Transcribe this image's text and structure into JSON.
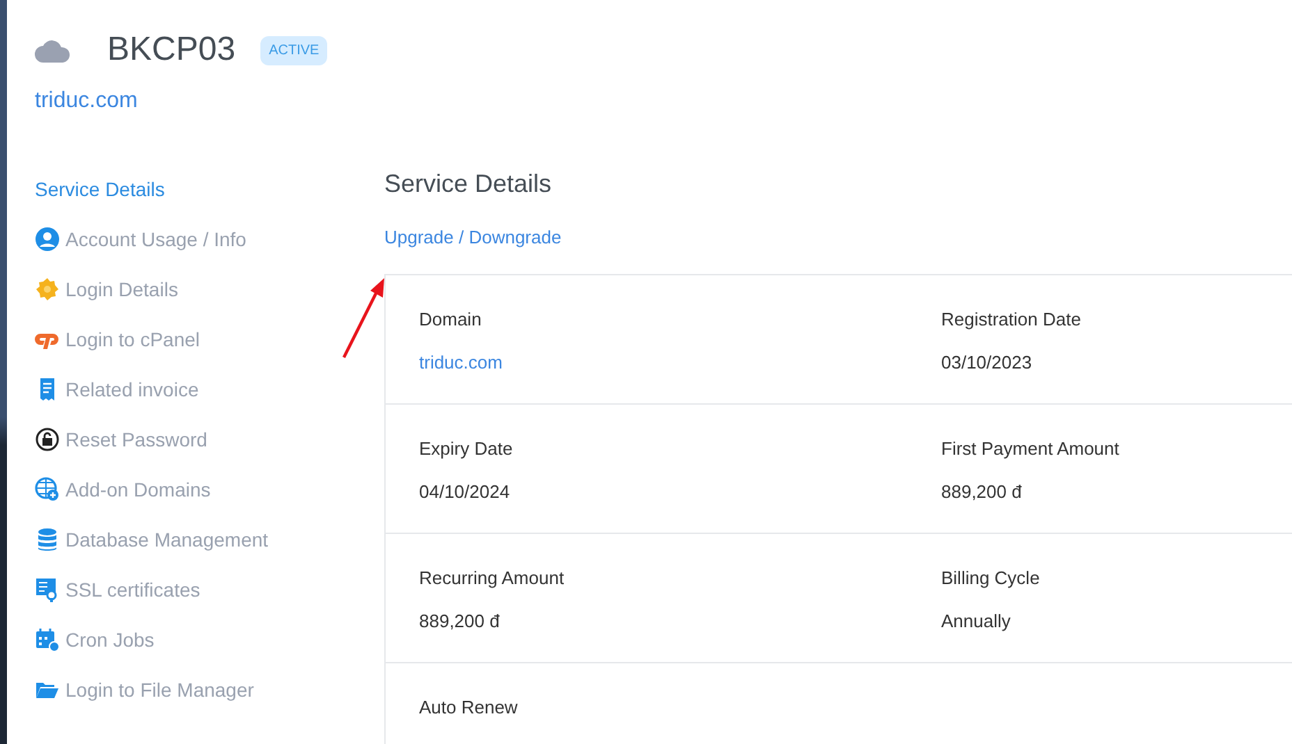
{
  "header": {
    "title": "BKCP03",
    "status": "ACTIVE",
    "domain": "triduc.com"
  },
  "sidebar": {
    "items": [
      {
        "label": "Service Details",
        "selected": true
      },
      {
        "label": "Account Usage / Info",
        "selected": false
      },
      {
        "label": "Login Details",
        "selected": false
      },
      {
        "label": "Login to cPanel",
        "selected": false
      },
      {
        "label": "Related invoice",
        "selected": false
      },
      {
        "label": "Reset Password",
        "selected": false
      },
      {
        "label": "Add-on Domains",
        "selected": false
      },
      {
        "label": "Database Management",
        "selected": false
      },
      {
        "label": "SSL certificates",
        "selected": false
      },
      {
        "label": "Cron Jobs",
        "selected": false
      },
      {
        "label": "Login to File Manager",
        "selected": false
      }
    ]
  },
  "main": {
    "title": "Service Details",
    "link": "Upgrade / Downgrade",
    "rows": [
      [
        {
          "label": "Domain",
          "value": "triduc.com",
          "kind": "link"
        },
        {
          "label": "Registration Date",
          "value": "03/10/2023",
          "kind": "text"
        }
      ],
      [
        {
          "label": "Expiry Date",
          "value": "04/10/2024",
          "kind": "text"
        },
        {
          "label": "First Payment Amount",
          "value": "889,200 đ",
          "kind": "text"
        }
      ],
      [
        {
          "label": "Recurring Amount",
          "value": "889,200 đ",
          "kind": "text"
        },
        {
          "label": "Billing Cycle",
          "value": "Annually",
          "kind": "text"
        }
      ],
      [
        {
          "label": "Auto Renew"
        }
      ]
    ]
  }
}
